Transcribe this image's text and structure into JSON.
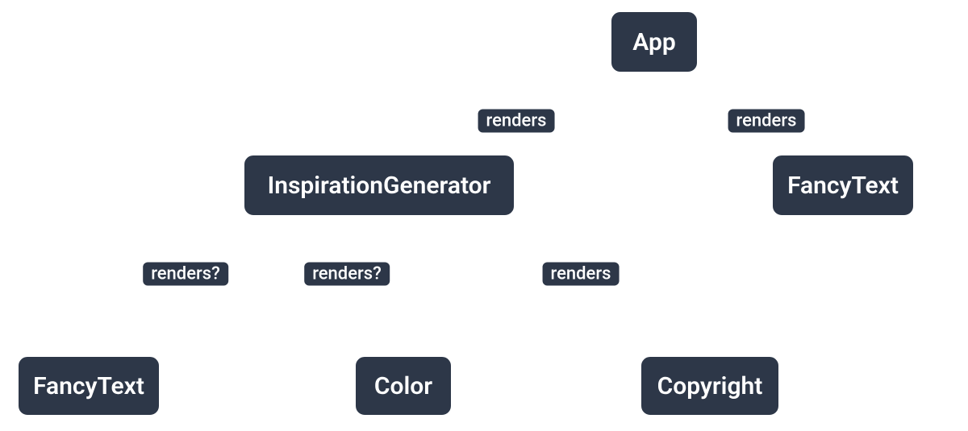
{
  "diagram": {
    "nodes": {
      "app": "App",
      "inspirationGenerator": "InspirationGenerator",
      "fancyTextTop": "FancyText",
      "fancyTextBottom": "FancyText",
      "color": "Color",
      "copyright": "Copyright"
    },
    "edgeLabels": {
      "app_to_ig": "renders",
      "app_to_ft": "renders",
      "ig_to_copyright": "renders",
      "ig_to_ft_cond": "renders?",
      "ig_to_color_cond": "renders?"
    },
    "colors": {
      "nodeFill": "#2d3748",
      "nodeBorder": "#ffffff",
      "edgeSolid": "#ffffff",
      "edgeDashed": "#ffffff"
    }
  }
}
